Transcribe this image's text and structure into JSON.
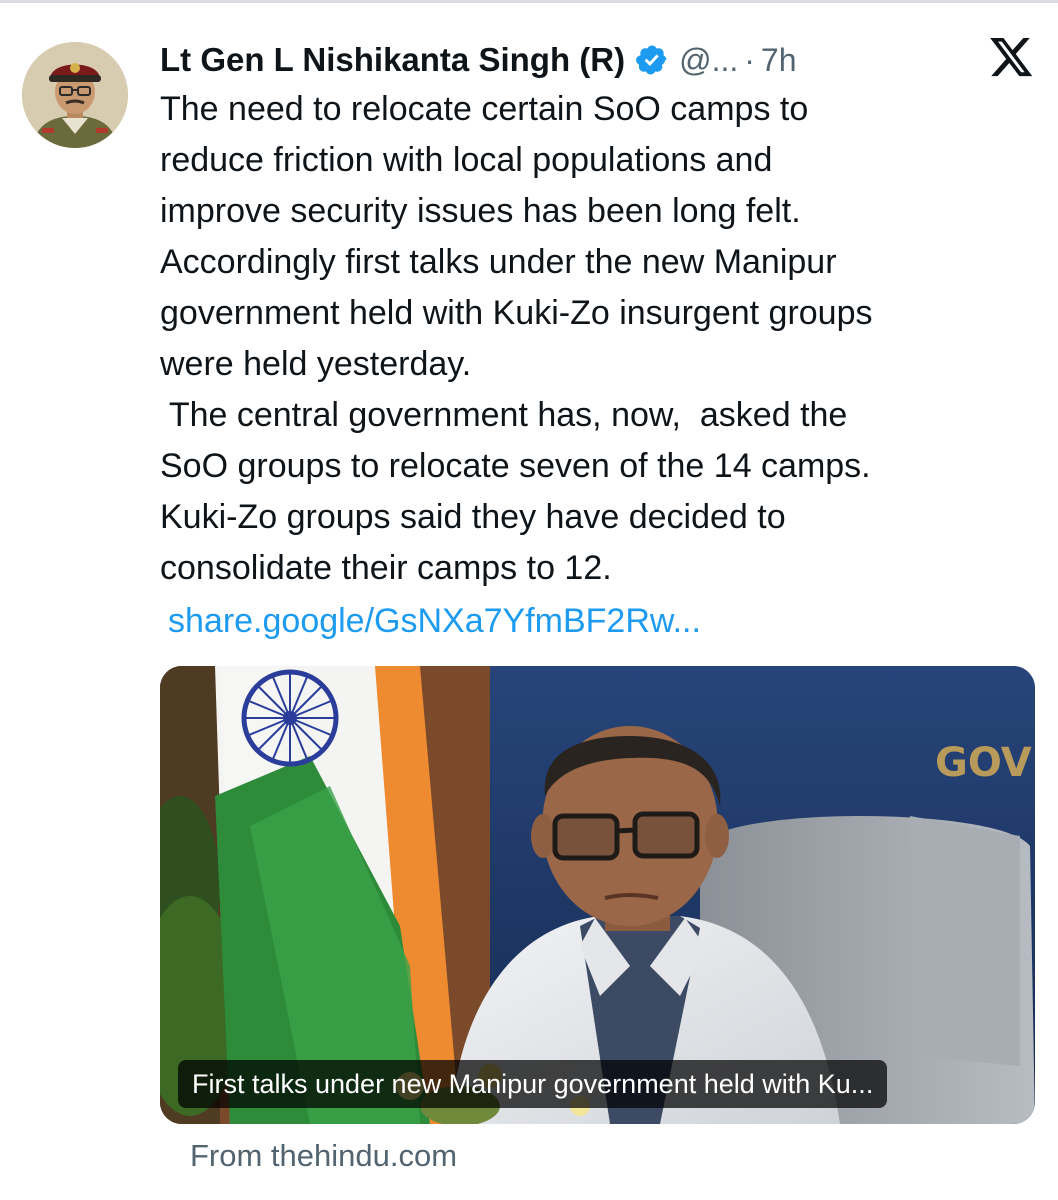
{
  "author": {
    "display_name": "Lt Gen L Nishikanta Singh (R)",
    "handle": "@...",
    "separator": "·",
    "time": "7h",
    "verified_icon": "verified-badge-icon",
    "avatar_icon": "avatar"
  },
  "platform_icon": "x-logo-icon",
  "tweet": {
    "lines": [
      "The need to relocate certain SoO camps to",
      "reduce friction with local populations and",
      "improve security issues has been long felt.",
      "Accordingly first talks under the new Manipur",
      "government held with Kuki-Zo insurgent groups",
      "were held yesterday.",
      " The central government has, now,  asked the",
      "SoO groups to relocate seven of the 14 camps.",
      "Kuki-Zo groups said they have decided to",
      "consolidate their camps to 12."
    ],
    "link": "share.google/GsNXa7YfmBF2Rw..."
  },
  "card": {
    "caption": "First talks under new Manipur government held with Ku...",
    "image_sign_text": "GOV",
    "source": "From thehindu.com"
  },
  "colors": {
    "text": "#0f1419",
    "secondary": "#536471",
    "link": "#1d9bf0",
    "verified": "#1d9bf0"
  }
}
